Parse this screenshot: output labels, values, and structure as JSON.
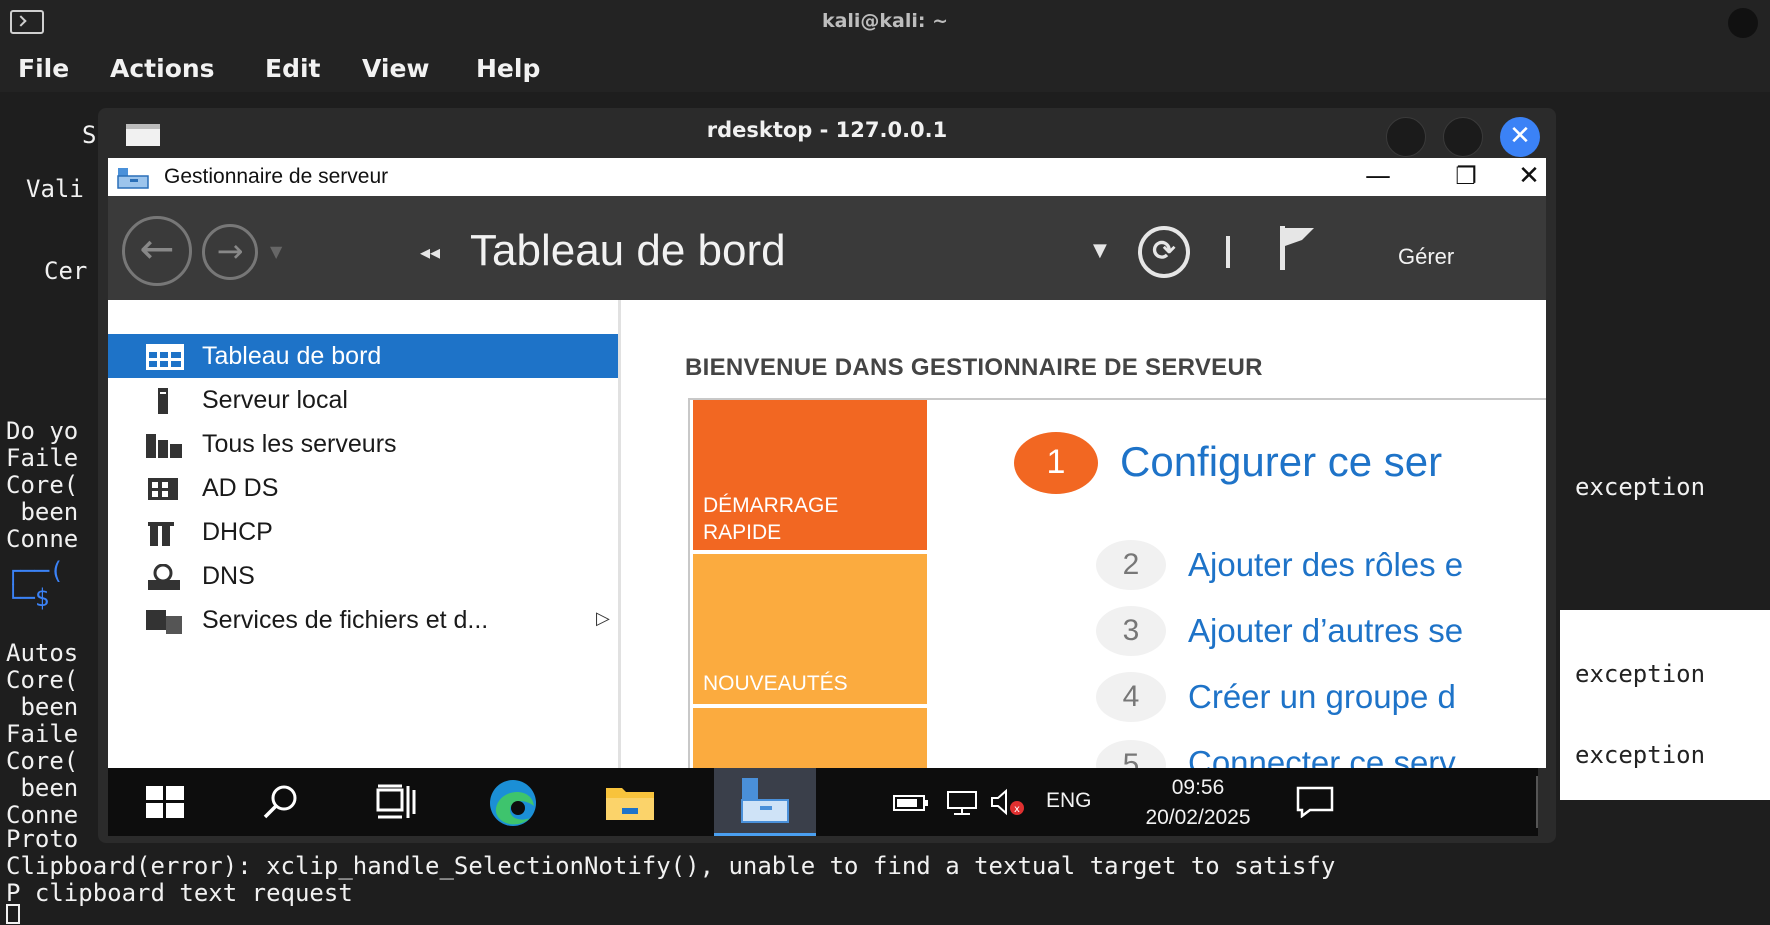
{
  "terminal": {
    "title": "kali@kali: ~",
    "menu": [
      "File",
      "Actions",
      "Edit",
      "View",
      "Help"
    ],
    "left_fragments": [
      "S",
      "Vali",
      "Cer",
      "Do yo",
      "Faile",
      "Core(",
      " been",
      "Conne",
      "Autos",
      "Core(",
      " been",
      "Faile",
      "Core(",
      " been",
      "Conne"
    ],
    "right_fragments": [
      "exception",
      "exception",
      "exception"
    ],
    "bottom_lines": [
      "Proto",
      "Clipboard(error): xclip_handle_SelectionNotify(), unable to find a textual target to satisfy",
      "P clipboard text request"
    ]
  },
  "rdesktop": {
    "title": "rdesktop - 127.0.0.1"
  },
  "server_manager": {
    "window_title": "Gestionnaire de serveur",
    "window_controls": {
      "minimize": "—",
      "restore": "❐",
      "close": "✕"
    },
    "header": {
      "title": "Tableau de bord",
      "manage": "Gérer",
      "back_arrow": "←",
      "forward_arrow": "→",
      "breadcrumb_arrows": "◂◂",
      "dropdown": "▼",
      "refresh": "⟳"
    },
    "sidebar": [
      {
        "label": "Tableau de bord",
        "icon": "dashboard-icon",
        "active": true
      },
      {
        "label": "Serveur local",
        "icon": "server-icon",
        "active": false
      },
      {
        "label": "Tous les serveurs",
        "icon": "servers-icon",
        "active": false
      },
      {
        "label": "AD DS",
        "icon": "adds-icon",
        "active": false
      },
      {
        "label": "DHCP",
        "icon": "dhcp-icon",
        "active": false
      },
      {
        "label": "DNS",
        "icon": "dns-icon",
        "active": false
      },
      {
        "label": "Services de fichiers et d...",
        "icon": "file-services-icon",
        "active": false
      }
    ],
    "welcome_heading": "BIENVENUE DANS GESTIONNAIRE DE SERVEUR",
    "tiles": [
      {
        "label": "DÉMARRAGE\nRAPIDE",
        "color": "#f26722"
      },
      {
        "label": "NOUVEAUTÉS",
        "color": "#fbab3f"
      },
      {
        "label": "",
        "color": "#fbab3f"
      }
    ],
    "steps": [
      {
        "number": "1",
        "text": "Configurer ce ser"
      },
      {
        "number": "2",
        "text": "Ajouter des rôles e"
      },
      {
        "number": "3",
        "text": "Ajouter d’autres se"
      },
      {
        "number": "4",
        "text": "Créer un groupe d"
      },
      {
        "number": "5",
        "text": "Connecter ce serv"
      }
    ]
  },
  "taskbar": {
    "language": "ENG",
    "time": "09:56",
    "date": "20/02/2025"
  },
  "colors": {
    "accent_blue": "#1e73c8",
    "tile_orange": "#f26722",
    "tile_amber": "#fbab3f",
    "close_blue": "#3b82f6"
  }
}
